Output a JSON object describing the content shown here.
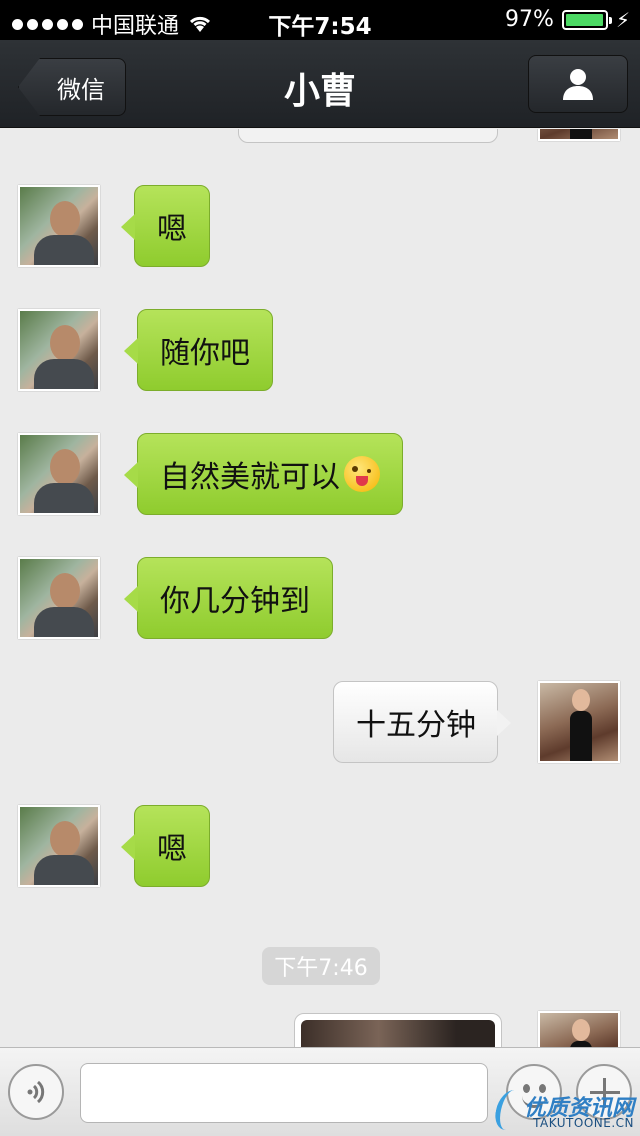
{
  "status_bar": {
    "carrier": "中国联通",
    "time": "下午7:54",
    "battery": "97%"
  },
  "nav": {
    "back_label": "微信",
    "title": "小曹"
  },
  "messages": [
    {
      "side": "in",
      "text": "嗯"
    },
    {
      "side": "in",
      "text": "随你吧"
    },
    {
      "side": "in",
      "text": "自然美就可以",
      "emoji": "winking-tongue-emoji"
    },
    {
      "side": "in",
      "text": "你几分钟到"
    },
    {
      "side": "out",
      "text": "十五分钟"
    },
    {
      "side": "in",
      "text": "嗯"
    }
  ],
  "timestamp": "下午7:46",
  "input": {
    "placeholder": ""
  },
  "watermark": {
    "text": "优质资讯网",
    "subtext": "TAKUTOONE.CN"
  },
  "colors": {
    "incoming_bubble": "#a6db48",
    "outgoing_bubble": "#f2f2f2",
    "nav_bar": "#2a2d31",
    "background": "#ebebeb",
    "battery": "#4cd964"
  }
}
